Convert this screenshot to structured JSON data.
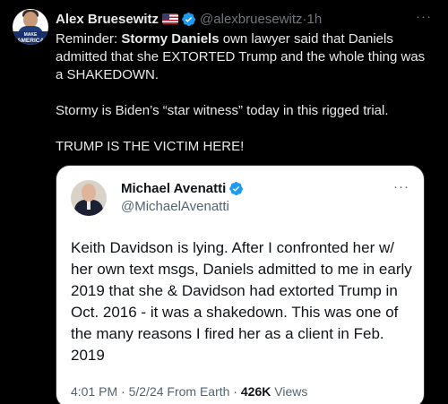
{
  "tweet": {
    "author_name": "Alex Bruesewitz",
    "handle": "@alexbruesewitz",
    "separator": " · ",
    "time": "1h",
    "more": "···",
    "avatar_text_top": "MAKE",
    "avatar_text_big": "AMERICA",
    "line1_pre": "Reminder: ",
    "line1_bold": "Stormy Daniels",
    "line1_post": " own lawyer said that Daniels admitted that she EXTORTED Trump and the whole thing was a SHAKEDOWN.",
    "line2": "Stormy is Biden’s “star witness” today in this rigged trial.",
    "line3": "TRUMP IS THE VICTIM HERE!"
  },
  "quote": {
    "author_name": "Michael Avenatti",
    "handle": "@MichaelAvenatti",
    "more": "···",
    "text": "Keith Davidson is lying. After I confronted her w/ her own text msgs, Daniels admitted to me in early 2019 that she & Davidson had extorted Trump in Oct. 2016 - it was a shakedown. This was one of the many reasons I fired her as a client in Feb. 2019",
    "time": "4:01 PM",
    "date": "5/2/24",
    "source": "From Earth",
    "views_count": "426K",
    "views_label": "Views"
  },
  "colors": {
    "background": "#000000",
    "verified": "#1d9bf0",
    "text_primary": "#e7e9ea",
    "text_secondary": "#71767b"
  }
}
